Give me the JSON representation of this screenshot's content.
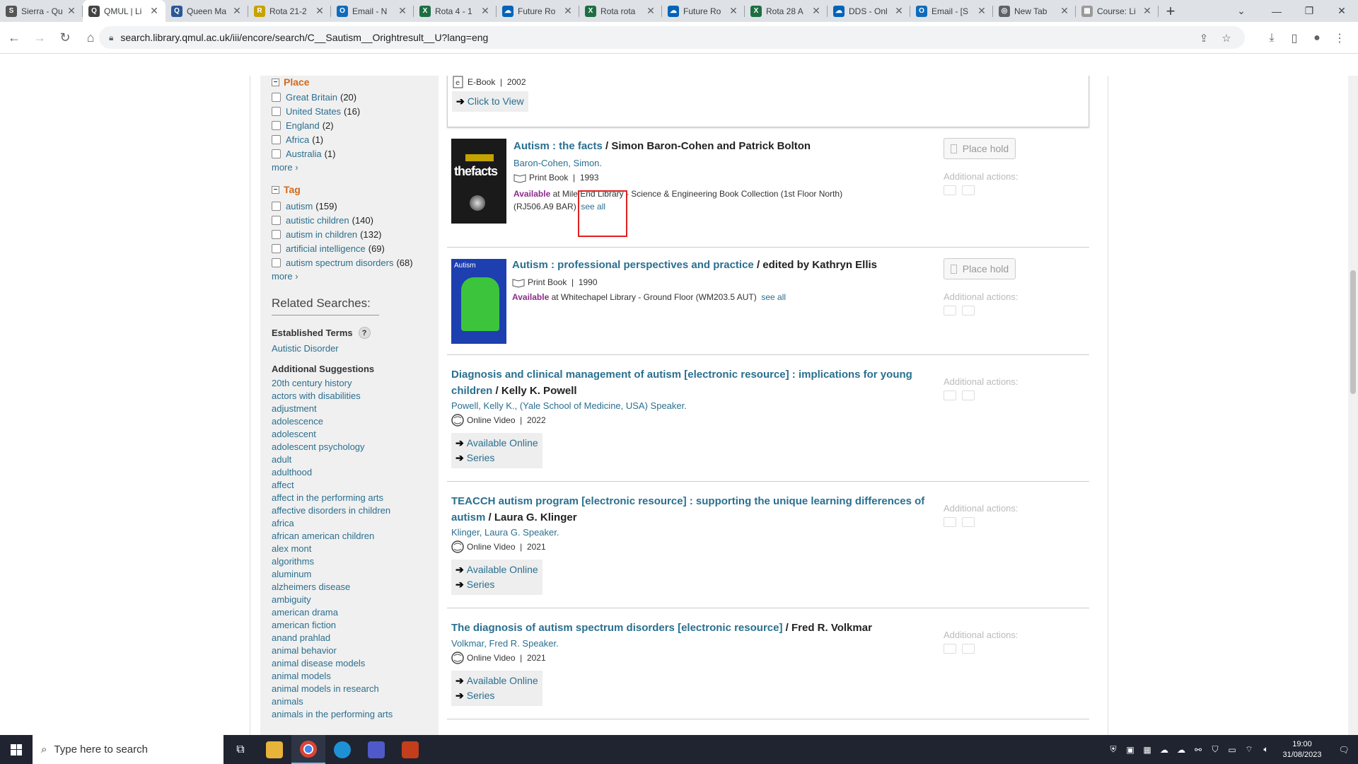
{
  "browser": {
    "tabs": [
      {
        "title": "Sierra - Qu",
        "color": "#555",
        "glyph": "S"
      },
      {
        "title": "QMUL | Li",
        "color": "#444",
        "glyph": "Q",
        "active": true
      },
      {
        "title": "Queen Ma",
        "color": "#2b5797",
        "glyph": "Q"
      },
      {
        "title": "Rota 21-2",
        "color": "#c8a200",
        "glyph": "R"
      },
      {
        "title": "Email - N",
        "color": "#0f6cbd",
        "glyph": "O"
      },
      {
        "title": "Rota 4 - 1",
        "color": "#1d6f42",
        "glyph": "X"
      },
      {
        "title": "Future Ro",
        "color": "#0364b8",
        "glyph": "☁"
      },
      {
        "title": "Rota rota",
        "color": "#1d6f42",
        "glyph": "X"
      },
      {
        "title": "Future Ro",
        "color": "#0364b8",
        "glyph": "☁"
      },
      {
        "title": "Rota 28 A",
        "color": "#1d6f42",
        "glyph": "X"
      },
      {
        "title": "DDS - Onl",
        "color": "#0364b8",
        "glyph": "☁"
      },
      {
        "title": "Email - [S",
        "color": "#0f6cbd",
        "glyph": "O"
      },
      {
        "title": "New Tab",
        "color": "#5f6368",
        "glyph": "◎"
      },
      {
        "title": "Course: Li",
        "color": "#999",
        "glyph": "▦"
      }
    ],
    "url": "search.library.qmul.ac.uk/iii/encore/search/C__Sautism__Orightresult__U?lang=eng"
  },
  "sidebar": {
    "place_heading": "Place",
    "place_items": [
      {
        "label": "Great Britain",
        "count": "(20)"
      },
      {
        "label": "United States",
        "count": "(16)"
      },
      {
        "label": "England",
        "count": "(2)"
      },
      {
        "label": "Africa",
        "count": "(1)"
      },
      {
        "label": "Australia",
        "count": "(1)"
      }
    ],
    "more_label": "more",
    "tag_heading": "Tag",
    "tag_items": [
      {
        "label": "autism",
        "count": "(159)"
      },
      {
        "label": "autistic children",
        "count": "(140)"
      },
      {
        "label": "autism in children",
        "count": "(132)"
      },
      {
        "label": "artificial intelligence",
        "count": "(69)"
      },
      {
        "label": "autism spectrum disorders",
        "count": "(68)"
      }
    ],
    "related_heading": "Related Searches:",
    "established_heading": "Established Terms",
    "established_link": "Autistic Disorder",
    "additional_heading": "Additional Suggestions",
    "suggestions": [
      "20th century history",
      "actors with disabilities",
      "adjustment",
      "adolescence",
      "adolescent",
      "adolescent psychology",
      "adult",
      "adulthood",
      "affect",
      "affect in the performing arts",
      "affective disorders in children",
      "africa",
      "african american children",
      "alex mont",
      "algorithms",
      "aluminum",
      "alzheimers disease",
      "ambiguity",
      "american drama",
      "american fiction",
      "anand prahlad",
      "animal behavior",
      "animal disease models",
      "animal models",
      "animal models in research",
      "animals",
      "animals in the performing arts"
    ]
  },
  "results": {
    "top_partial": {
      "format": "E-Book",
      "year": "2002",
      "link": "Click to View"
    },
    "items": [
      {
        "title": "Autism : the facts",
        "sep": " / ",
        "author_stmt": "Simon Baron-Cohen and Patrick Bolton",
        "by": "Baron-Cohen, Simon.",
        "format": "Print Book",
        "year": "1993",
        "avail_label": "Available",
        "avail_text": " at Mile End Library - Science & Engineering Book Collection (1st Floor North)",
        "callno": "(RJ506.A9 BAR)",
        "see_all": "see all",
        "place_hold": "Place hold",
        "additional": "Additional actions:"
      },
      {
        "title": "Autism : professional perspectives and practice",
        "sep": " / ",
        "author_stmt": "edited by Kathryn Ellis",
        "format": "Print Book",
        "year": "1990",
        "avail_label": "Available",
        "avail_text": " at Whitechapel Library - Ground Floor (WM203.5 AUT)",
        "see_all": "see all",
        "place_hold": "Place hold",
        "additional": "Additional actions:"
      },
      {
        "title": "Diagnosis and clinical management of autism [electronic resource] : implications for young children",
        "sep": " / ",
        "author_stmt": "Kelly K. Powell",
        "by": "Powell, Kelly K., (Yale School of Medicine, USA) Speaker.",
        "format": "Online Video",
        "year": "2022",
        "link1": "Available Online",
        "link2": "Series",
        "additional": "Additional actions:"
      },
      {
        "title": "TEACCH autism program [electronic resource] : supporting the unique learning differences of autism",
        "sep": " / ",
        "author_stmt": "Laura G. Klinger",
        "by": "Klinger, Laura G. Speaker.",
        "format": "Online Video",
        "year": "2021",
        "link1": "Available Online",
        "link2": "Series",
        "additional": "Additional actions:"
      },
      {
        "title": "The diagnosis of autism spectrum disorders [electronic resource]",
        "sep": " / ",
        "author_stmt": "Fred R. Volkmar",
        "by": "Volkmar, Fred R. Speaker.",
        "format": "Online Video",
        "year": "2021",
        "link1": "Available Online",
        "link2": "Series",
        "additional": "Additional actions:"
      }
    ],
    "covers": [
      {
        "brand": "thefacts",
        "bg": "#1a1a1a"
      },
      {
        "brand": "Autism",
        "bg": "#1d3fb0"
      }
    ]
  },
  "taskbar": {
    "search_placeholder": "Type here to search",
    "time": "19:00",
    "date": "31/08/2023"
  }
}
